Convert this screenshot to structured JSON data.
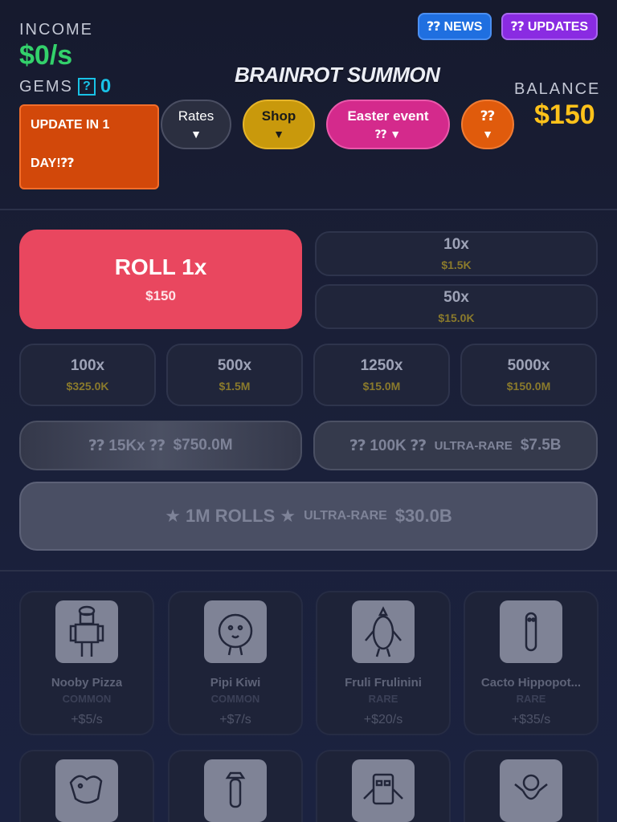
{
  "header": {
    "income_label": "INCOME",
    "income_value": "$0/s",
    "gems_label": "GEMS",
    "gems_icon": "?",
    "gems_value": "0",
    "title": "BRAINROT SUMMON",
    "balance_label": "BALANCE",
    "balance_value": "$150",
    "news_label": "⁇ NEWS",
    "updates_label": "⁇ UPDATES",
    "update_line1": "UPDATE IN 1",
    "update_line2": "DAY!⁇"
  },
  "nav": {
    "rates": "Rates",
    "shop": "Shop",
    "easter": "Easter event",
    "easter_sub": "⁇ ▼",
    "q": "⁇",
    "arrow": "▼"
  },
  "rolls": {
    "roll1_label": "ROLL 1x",
    "roll1_price": "$150",
    "r10_label": "10x",
    "r10_price": "$1.5K",
    "r50_label": "50x",
    "r50_price": "$15.0K",
    "r100_label": "100x",
    "r100_price": "$325.0K",
    "r500_label": "500x",
    "r500_price": "$1.5M",
    "r1250_label": "1250x",
    "r1250_price": "$15.0M",
    "r5000_label": "5000x",
    "r5000_price": "$150.0M",
    "r15k_label": "⁇ 15Kx ⁇",
    "r15k_price": "$750.0M",
    "r100k_label": "⁇ 100K ⁇",
    "r100k_tag": "ULTRA-RARE",
    "r100k_price": "$7.5B",
    "r1m_label": "★ 1M ROLLS ★",
    "r1m_tag": "ULTRA-RARE",
    "r1m_price": "$30.0B"
  },
  "cards": [
    {
      "name": "Nooby Pizza",
      "rarity": "COMMON",
      "income": "+$5/s"
    },
    {
      "name": "Pipi Kiwi",
      "rarity": "COMMON",
      "income": "+$7/s"
    },
    {
      "name": "Fruli Frulinini",
      "rarity": "RARE",
      "income": "+$20/s"
    },
    {
      "name": "Cacto Hippopot...",
      "rarity": "RARE",
      "income": "+$35/s"
    }
  ],
  "colors": {
    "income": "#33d16b",
    "gems": "#19c2e6",
    "balance": "#ffc21a",
    "roll1": "#e9475f",
    "price_gold": "#8a7a2c"
  }
}
